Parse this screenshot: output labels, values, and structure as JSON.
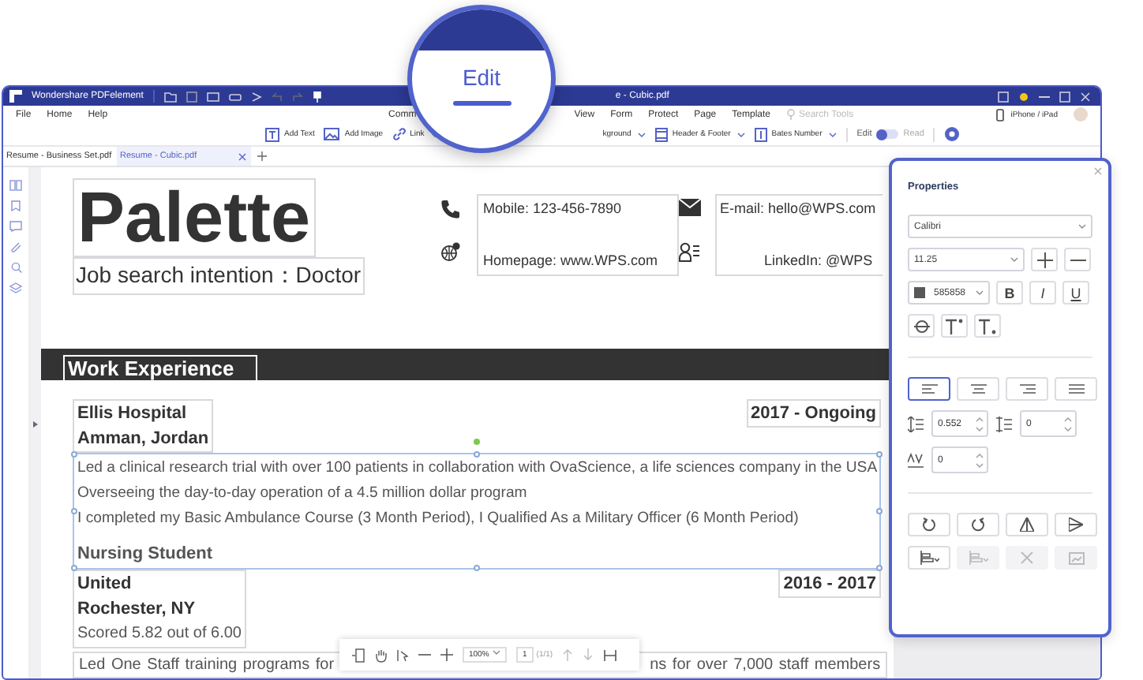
{
  "window": {
    "title": "Wondershare PDFelement",
    "title_tail": "e - Cubic.pdf"
  },
  "magnifier": {
    "label": "Edit"
  },
  "menu": [
    "File",
    "Home",
    "Help",
    "Comm"
  ],
  "menu_right": [
    "View",
    "Form",
    "Protect",
    "Page",
    "Template"
  ],
  "search": {
    "placeholder": "Search Tools"
  },
  "device_label": "iPhone / iPad",
  "toolbar_left": [
    {
      "label": "Add Text",
      "dropdown": false
    },
    {
      "label": "Add Image",
      "dropdown": false
    },
    {
      "label": "Link",
      "dropdown": true
    }
  ],
  "toolbar_right": [
    {
      "label": "kground",
      "dropdown": true
    },
    {
      "label": "Header & Footer",
      "dropdown": true
    },
    {
      "label": "Bates Number",
      "dropdown": true
    }
  ],
  "mode_toggle": {
    "edit_label": "Edit",
    "read_label": "Read",
    "edit_selected": true
  },
  "tabs": [
    {
      "label": "Resume - Business Set.pdf",
      "selected": false
    },
    {
      "label": "Resume - Cubic.pdf",
      "selected": true
    }
  ],
  "document": {
    "name": "Palette",
    "intention": "Job search intention：Doctor",
    "contacts": [
      {
        "text": "Mobile: 123-456-7890"
      },
      {
        "text": "Homepage: www.WPS.com"
      },
      {
        "text": "E-mail: hello@WPS.com"
      },
      {
        "text": "LinkedIn: @WPS"
      }
    ],
    "section": "Work Experience",
    "entry1": {
      "place": "Ellis Hospital",
      "city": "Amman,  Jordan",
      "dates": "2017 - Ongoing"
    },
    "selected_lines": [
      "Led a clinical research trial with over 100 patients in collaboration with OvaScience, a life sciences company in the USA",
      "Overseeing the day-to-day operation of a 4.5 million dollar program",
      "I completed my Basic Ambulance Course (3 Month Period), I Qualified As a Military Officer (6 Month Period)"
    ],
    "role": "Nursing Student",
    "entry2": {
      "place": "United",
      "city": "Rochester, NY",
      "dates": "2016 - 2017",
      "score": "Scored 5.82 out of 6.00"
    },
    "last_line_start": "Led  One  Staff  training  programs  for",
    "last_line_end": "ns for over 7,000 staff members"
  },
  "view_bar": {
    "zoom": "100%",
    "page": "1",
    "page_count": "(1/1)"
  },
  "panel": {
    "title": "Properties",
    "font": "Calibri",
    "size": "11.25",
    "color_value": "585858",
    "color": "#585858",
    "format_buttons": [
      "B",
      "I",
      "U"
    ],
    "alignment": [
      {
        "selected": true
      },
      {
        "selected": false
      },
      {
        "selected": false
      },
      {
        "selected": false
      }
    ],
    "line_spacing": "0.552",
    "paragraph_spacing": "0",
    "char_spacing": "0"
  }
}
